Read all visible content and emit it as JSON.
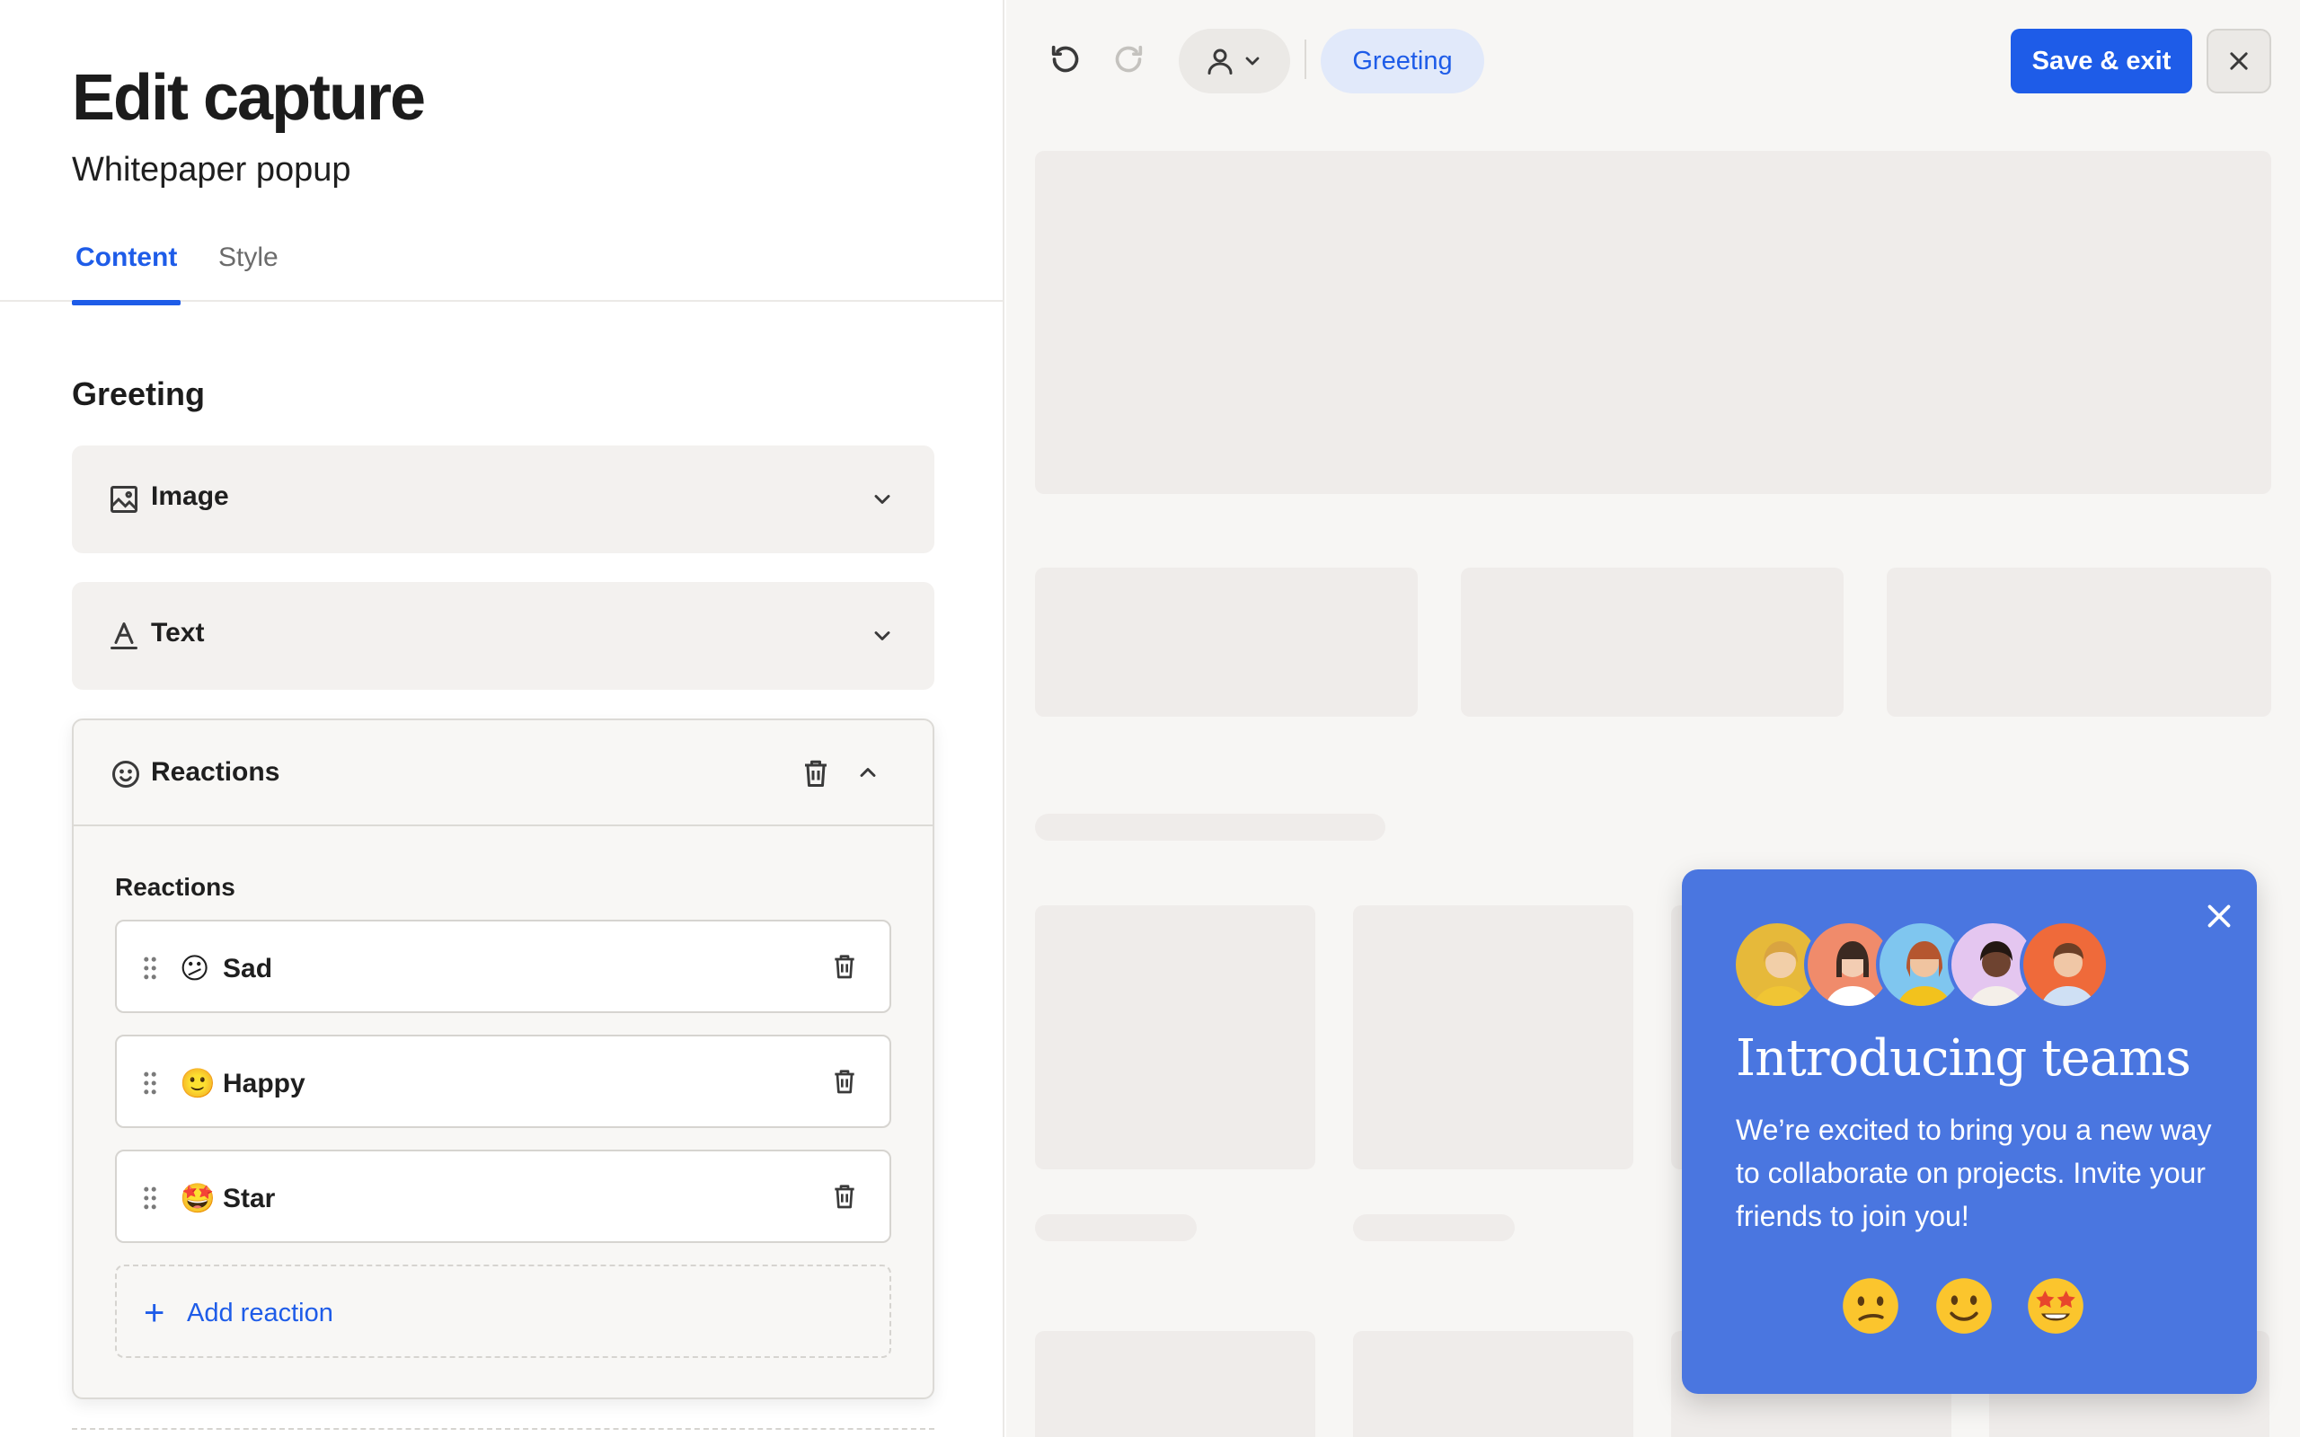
{
  "editor": {
    "title": "Edit capture",
    "subtitle": "Whitepaper popup",
    "tabs": [
      {
        "label": "Content",
        "active": true
      },
      {
        "label": "Style",
        "active": false
      }
    ],
    "section_heading": "Greeting",
    "accordions": {
      "image": {
        "label": "Image",
        "icon": "image-icon",
        "expanded": false
      },
      "text": {
        "label": "Text",
        "icon": "text-icon",
        "expanded": false
      },
      "reactions": {
        "label": "Reactions",
        "icon": "smiley-icon",
        "expanded": true,
        "sub_label": "Reactions",
        "items": [
          {
            "emoji": "😕",
            "label": "Sad"
          },
          {
            "emoji": "🙂",
            "label": "Happy"
          },
          {
            "emoji": "🤩",
            "label": "Star"
          }
        ],
        "add_label": "Add reaction"
      }
    }
  },
  "toolbar": {
    "undo_icon": "undo-icon",
    "redo_icon": "redo-icon",
    "user_icon": "user-icon",
    "context_pill": "Greeting",
    "save_label": "Save & exit",
    "close_icon": "close-icon"
  },
  "popup": {
    "title": "Introducing teams",
    "body": "We’re excited to bring you a new way to collaborate on projects. Invite your friends to join you!",
    "reactions": [
      "sad-emoji",
      "happy-emoji",
      "star-struck-emoji"
    ],
    "avatar_colors": [
      "#e6b93a",
      "#f08b6b",
      "#7fc6ef",
      "#e4c6f0",
      "#ef6a3a"
    ]
  },
  "colors": {
    "accent": "#1e5ce8",
    "popup_bg": "#4a76e0",
    "skeleton": "#efecea",
    "canvas_bg": "#f7f6f4"
  }
}
